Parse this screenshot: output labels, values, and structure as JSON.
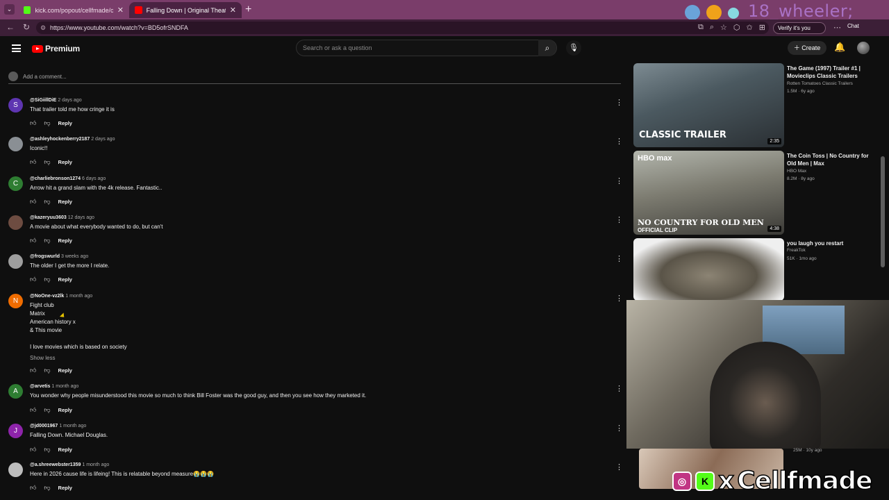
{
  "browser": {
    "tabs": [
      {
        "title": "kick.com/popout/cellfmade/chat",
        "favicon_color": "#53fc18"
      },
      {
        "title": "Falling Down | Original Theatrical",
        "favicon_color": "#ff0000"
      }
    ],
    "url": "https://www.youtube.com/watch?v=BD5ofrSNDFA",
    "verify_label": "Verify it's you",
    "chat_label": "Chat",
    "overlay_name": "18_wheeler;"
  },
  "header": {
    "logo_text": "Premium",
    "search_placeholder": "Search or ask a question",
    "create_label": "Create"
  },
  "add_comment_placeholder": "Add a comment...",
  "comments": [
    {
      "avatar_letter": "S",
      "avatar_color": "#5e35b1",
      "handle": "@SiGiillDiE",
      "time": "2 days ago",
      "lines": [
        "That trailer told me how cringe it is"
      ],
      "reply": "Reply"
    },
    {
      "avatar_letter": "",
      "avatar_color": "#8a8f94",
      "handle": "@ashleyhockenberry2187",
      "time": "2 days ago",
      "lines": [
        "Iconic!!"
      ],
      "reply": "Reply"
    },
    {
      "avatar_letter": "C",
      "avatar_color": "#2e7d32",
      "handle": "@charliebronson1274",
      "time": "6 days ago",
      "lines": [
        "Arrow hit a grand slam with the 4k release. Fantastic.."
      ],
      "reply": "Reply"
    },
    {
      "avatar_letter": "",
      "avatar_color": "#6d4c41",
      "handle": "@kazeryuu3603",
      "time": "12 days ago",
      "lines": [
        "A movie about what everybody wanted to do, but can't"
      ],
      "reply": "Reply"
    },
    {
      "avatar_letter": "",
      "avatar_color": "#9e9e9e",
      "handle": "@frogswurld",
      "time": "3 weeks ago",
      "lines": [
        "The older I get the more I relate."
      ],
      "reply": "Reply"
    },
    {
      "avatar_letter": "N",
      "avatar_color": "#ef6c00",
      "handle": "@NoOne-vz2lk",
      "time": "1 month ago",
      "lines": [
        "Fight club",
        "Matrix",
        "American history x",
        "& This movie",
        "",
        "I love movies which is based on society"
      ],
      "show_less": "Show less",
      "reply": "Reply"
    },
    {
      "avatar_letter": "A",
      "avatar_color": "#2e7d32",
      "handle": "@arvetis",
      "time": "1 month ago",
      "lines": [
        "You wonder why people misunderstood this movie so much to think Bill Foster was the good guy, and then you see how they marketed it."
      ],
      "reply": "Reply"
    },
    {
      "avatar_letter": "J",
      "avatar_color": "#8e24aa",
      "handle": "@jd0001967",
      "time": "1 month ago",
      "lines": [
        "Falling Down.  Michael Douglas."
      ],
      "reply": "Reply"
    },
    {
      "avatar_letter": "",
      "avatar_color": "#bdbdbd",
      "handle": "@a.shreewebster1359",
      "time": "1 month ago",
      "lines": [
        "Here in 2026 cause life is lifeing! This is relatable beyond measure😭😭😭"
      ],
      "reply": "Reply"
    }
  ],
  "sidebar": [
    {
      "title": "The Game (1997) Trailer #1 | Movieclips Classic Trailers",
      "channel": "Rotten Tomatoes Classic Trailers",
      "stats": "1.5M · 6y ago",
      "duration": "2:35",
      "thumb_caption": "CLASSIC TRAILER"
    },
    {
      "title": "The Coin Toss | No Country for Old Men | Max",
      "channel": "HBO Max",
      "stats": "8.2M · 8y ago",
      "duration": "4:38",
      "thumb_badge": "HBO max",
      "thumb_caption": "NO COUNTRY FOR OLD MEN",
      "thumb_sub": "OFFICIAL CLIP"
    },
    {
      "title": "you laugh you restart",
      "channel": "FreakTok",
      "stats": "51K · 1mo ago",
      "duration": ""
    }
  ],
  "bottom_video_stats": "25M · 10y ago",
  "brand": {
    "name": "Cellfmade",
    "x_mark": "x"
  }
}
